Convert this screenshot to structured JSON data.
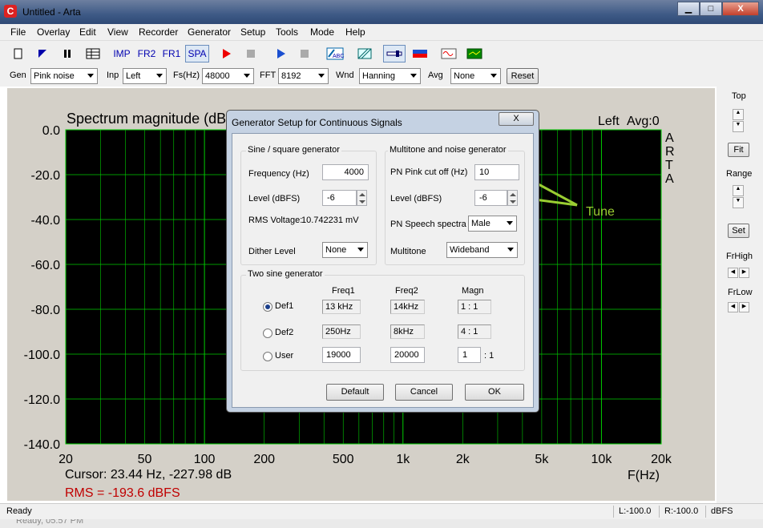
{
  "window": {
    "title": "Untitled - Arta",
    "icon": "C",
    "min": "▁",
    "max": "□",
    "close": "X"
  },
  "menu": [
    "File",
    "Overlay",
    "Edit",
    "View",
    "Recorder",
    "Generator",
    "Setup",
    "Tools",
    "Mode",
    "Help"
  ],
  "toolbar": {
    "imp": "IMP",
    "fr2": "FR2",
    "fr1": "FR1",
    "spa": "SPA",
    "abc": "ABC"
  },
  "combos": {
    "gen_label": "Gen",
    "gen": "Pink noise",
    "inp_label": "Inp",
    "inp": "Left",
    "fs_label": "Fs(Hz)",
    "fs": "48000",
    "fft_label": "FFT",
    "fft": "8192",
    "wnd_label": "Wnd",
    "wnd": "Hanning",
    "avg_label": "Avg",
    "avg": "None",
    "reset": "Reset"
  },
  "plot": {
    "title": "Spectrum magnitude (dB",
    "channel": "Left",
    "avg": "Avg:0",
    "logo": [
      "A",
      "R",
      "T",
      "A"
    ],
    "cursor": "Cursor: 23.44 Hz, -227.98 dB",
    "rms": "RMS = -193.6 dBFS",
    "xaxis_label": "F(Hz)",
    "y_ticks": [
      "0.0",
      "-20.0",
      "-40.0",
      "-60.0",
      "-80.0",
      "-100.0",
      "-120.0",
      "-140.0"
    ],
    "x_ticks": [
      "20",
      "50",
      "100",
      "200",
      "500",
      "1k",
      "2k",
      "5k",
      "10k",
      "20k"
    ],
    "annotation": "Tune",
    "grid_color": "#00cc00",
    "background": "#000000"
  },
  "right_panel": {
    "top": "Top",
    "fit": "Fit",
    "range": "Range",
    "set": "Set",
    "frhigh": "FrHigh",
    "frlow": "FrLow"
  },
  "status": {
    "ready": "Ready",
    "l": "L:-100.0",
    "r": "R:-100.0",
    "unit": "dBFS",
    "below": "Ready, 05:57 PM"
  },
  "dialog": {
    "title": "Generator Setup for Continuous Signals",
    "close": "X",
    "sine_group": "Sine / square generator",
    "freq_label": "Frequency (Hz)",
    "freq": "4000",
    "level_label": "Level (dBFS)",
    "level": "-6",
    "rms_label": "RMS Voltage:",
    "rms": "10.742231 mV",
    "dither_label": "Dither Level",
    "dither": "None",
    "multi_group": "Multitone and noise generator",
    "pink_label": "PN Pink cut off (Hz)",
    "pink": "10",
    "mlevel_label": "Level (dBFS)",
    "mlevel": "-6",
    "speech_label": "PN Speech spectra",
    "speech": "Male",
    "multitone_label": "Multitone",
    "multitone": "Wideband",
    "two_group": "Two sine generator",
    "col_freq1": "Freq1",
    "col_freq2": "Freq2",
    "col_magn": "Magn",
    "rows": [
      {
        "label": "Def1",
        "f1": "13 kHz",
        "f2": "14kHz",
        "magn": "1 : 1",
        "selected": true
      },
      {
        "label": "Def2",
        "f1": "250Hz",
        "f2": "8kHz",
        "magn": "4 : 1",
        "selected": false
      },
      {
        "label": "User",
        "f1": "19000",
        "f2": "20000",
        "magn": "1",
        "selected": false
      }
    ],
    "magn_suffix": ": 1",
    "default_btn": "Default",
    "cancel_btn": "Cancel",
    "ok_btn": "OK"
  }
}
